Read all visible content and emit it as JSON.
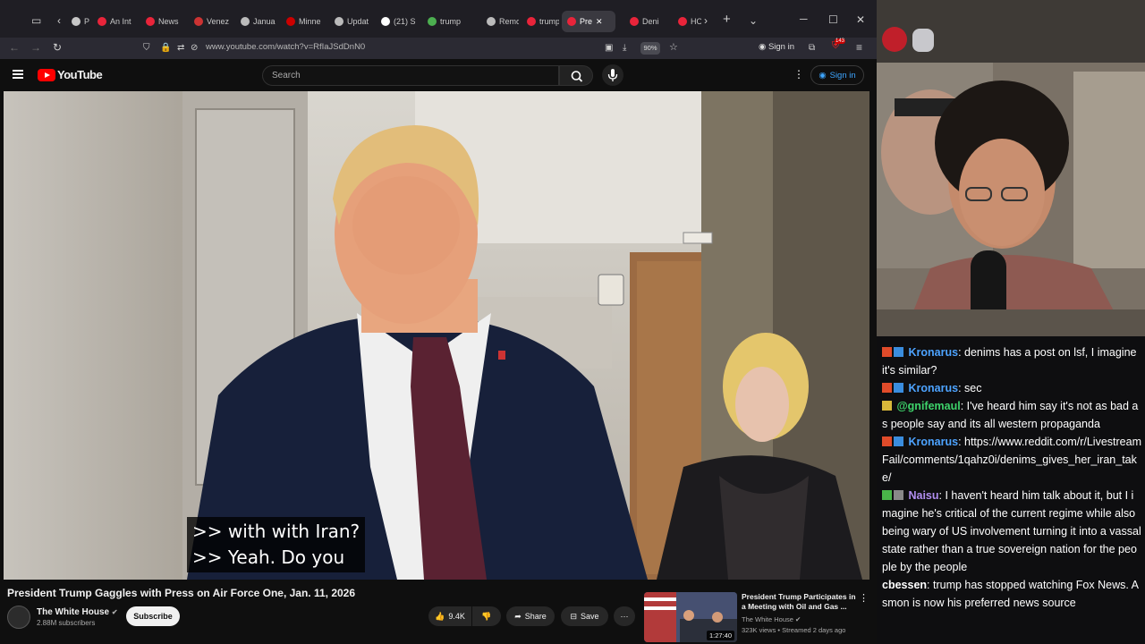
{
  "browser": {
    "tabs": [
      {
        "label": "Pul",
        "color": "#c7c7c7",
        "active": false
      },
      {
        "label": "An Int",
        "color": "#e9243a",
        "active": false
      },
      {
        "label": "News",
        "color": "#e9243a",
        "active": false
      },
      {
        "label": "Venez",
        "color": "#cc3333",
        "active": false
      },
      {
        "label": "Janua",
        "color": "#bbbbbb",
        "active": false
      },
      {
        "label": "Minne",
        "color": "#cc0000",
        "active": false
      },
      {
        "label": "Updat",
        "color": "#bbbbbb",
        "active": false
      },
      {
        "label": "(21) S",
        "color": "#ffffff",
        "active": false
      },
      {
        "label": "trump",
        "color": "#4caf50",
        "active": false
      },
      {
        "label": "Remo",
        "color": "#bbbbbb",
        "active": false
      },
      {
        "label": "trump",
        "color": "#e9243a",
        "active": false
      },
      {
        "label": "Pre",
        "color": "#e9243a",
        "active": true
      },
      {
        "label": "Deni",
        "color": "#e9243a",
        "active": false
      },
      {
        "label": "HO",
        "color": "#e9243a",
        "active": false
      }
    ],
    "url": "www.youtube.com/watch?v=RfIaJSdDnN0",
    "zoom": "90%",
    "signin_label": "Sign in",
    "extension_badge": "143"
  },
  "youtube": {
    "logo_text": "YouTube",
    "search_placeholder": "Search",
    "signin_label": "Sign in"
  },
  "video": {
    "captions": [
      ">> with with Iran?",
      ">> Yeah. Do you"
    ],
    "title": "President Trump Gaggles with Press on Air Force One, Jan. 11, 2026",
    "channel": "The White House",
    "subscribers": "2.88M subscribers",
    "subscribe_label": "Subscribe",
    "likes": "9.4K",
    "share_label": "Share",
    "save_label": "Save"
  },
  "recommended": {
    "title": "President Trump Participates in a Meeting with Oil and Gas ...",
    "channel": "The White House",
    "meta": "323K views • Streamed 2 days ago",
    "duration": "1:27:40"
  },
  "chat": {
    "messages": [
      {
        "badges": [
          "#e04b2a",
          "#3a8dde"
        ],
        "user": "Kronarus",
        "user_color": "#4da3ff",
        "text": ": denims has a post on lsf, I imagine it's similar?"
      },
      {
        "badges": [
          "#e04b2a",
          "#3a8dde"
        ],
        "user": "Kronarus",
        "user_color": "#4da3ff",
        "text": ": sec"
      },
      {
        "badges": [
          "#d9b83a"
        ],
        "user": "@gnifemaul",
        "user_color": "#3ed36b",
        "text": ": I've heard him say it's not as bad as people say and its all western propaganda"
      },
      {
        "badges": [
          "#e04b2a",
          "#3a8dde"
        ],
        "user": "Kronarus",
        "user_color": "#4da3ff",
        "text": ": https://www.reddit.com/r/LivestreamFail/comments/1qahz0i/denims_gives_her_iran_take/"
      },
      {
        "badges": [
          "#49b649",
          "#888888"
        ],
        "user": "Naisu",
        "user_color": "#b18ef0",
        "text": ": I haven't heard him talk about it, but I imagine he's critical of the current regime while also being wary of US involvement turning it into a vassal state rather than a true sovereign nation for the people by the people"
      },
      {
        "badges": [],
        "user": "cbessen",
        "user_color": "#ffffff",
        "text": ": trump has stopped watching Fox News. Asmon is now his preferred news source"
      }
    ]
  }
}
